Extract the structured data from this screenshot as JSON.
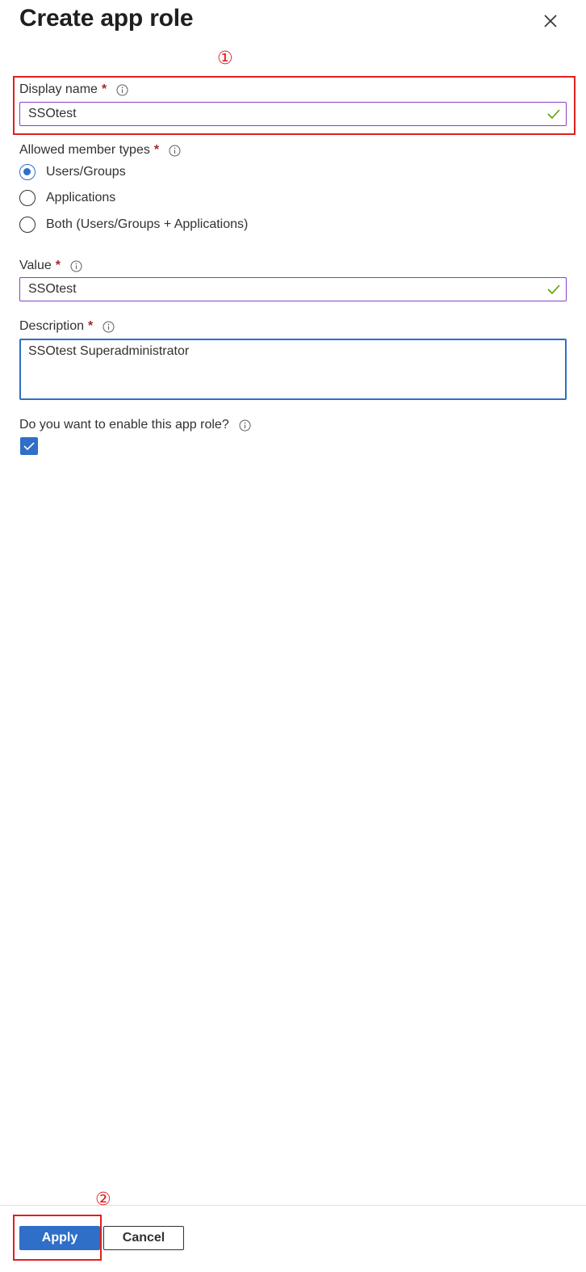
{
  "panel": {
    "title": "Create app role",
    "close_icon": "close-icon"
  },
  "annotations": {
    "step1": "①",
    "step2": "②",
    "color": "#e02020"
  },
  "display_name": {
    "label": "Display name",
    "required_mark": "*",
    "value": "SSOtest",
    "valid_icon": "checkmark-icon"
  },
  "member_types": {
    "label": "Allowed member types",
    "required_mark": "*",
    "options": [
      {
        "label": "Users/Groups",
        "selected": true
      },
      {
        "label": "Applications",
        "selected": false
      },
      {
        "label": "Both (Users/Groups + Applications)",
        "selected": false
      }
    ]
  },
  "value_field": {
    "label": "Value",
    "required_mark": "*",
    "value": "SSOtest",
    "valid_icon": "checkmark-icon"
  },
  "description": {
    "label": "Description",
    "required_mark": "*",
    "value": "SSOtest Superadministrator"
  },
  "enable": {
    "label": "Do you want to enable this app role?",
    "checked": true
  },
  "footer": {
    "apply_label": "Apply",
    "cancel_label": "Cancel"
  },
  "colors": {
    "accent": "#2f6fc7",
    "valid": "#57a300",
    "required": "#a4262c"
  }
}
